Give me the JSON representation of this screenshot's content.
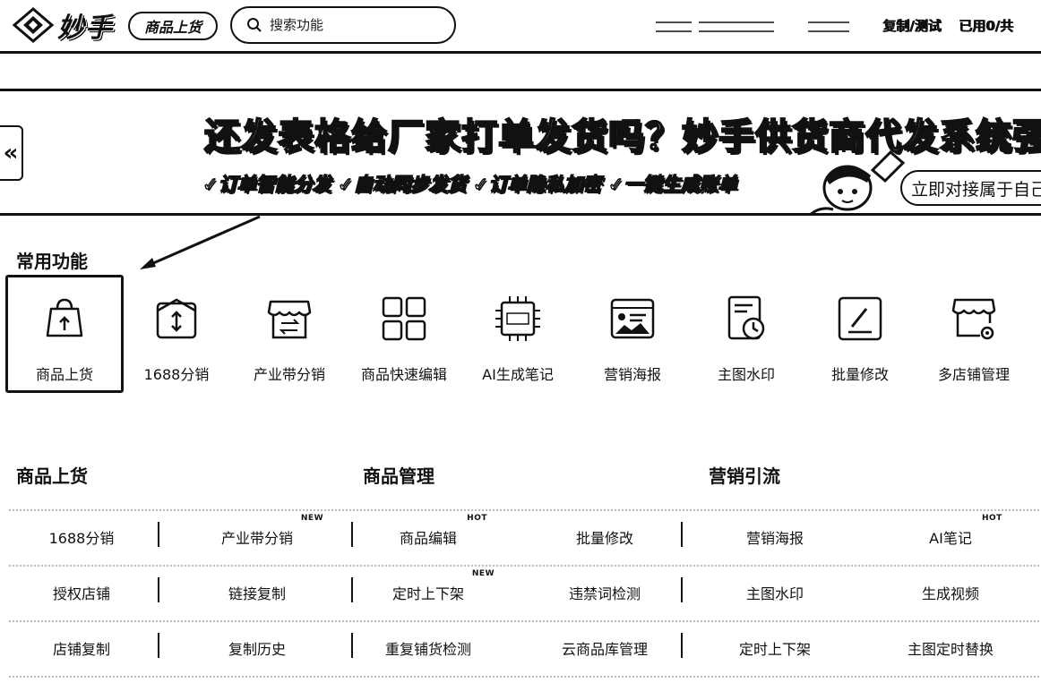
{
  "header": {
    "logo_text": "妙手",
    "module_label": "商品上货",
    "search_placeholder": "搜索功能",
    "link_review": "复制/测试",
    "link_usage": "已用0/共"
  },
  "banner": {
    "prev_icon": "«",
    "headline": "还发表格给厂家打单发货吗？妙手供货商代发系统强势来袭",
    "features": "✓订单智能分发 ✓自动同步发货 ✓订单隐私加密 ✓一键生成账单",
    "cta": "立即对接属于自己的"
  },
  "common": {
    "title": "常用功能",
    "items": [
      {
        "label": "商品上货",
        "icon": "shopping-bag-upload-icon"
      },
      {
        "label": "1688分销",
        "icon": "box-transfer-icon"
      },
      {
        "label": "产业带分销",
        "icon": "storefront-exchange-icon"
      },
      {
        "label": "商品快速编辑",
        "icon": "grid-four-icon"
      },
      {
        "label": "AI生成笔记",
        "icon": "ai-chip-icon"
      },
      {
        "label": "营销海报",
        "icon": "poster-icon"
      },
      {
        "label": "主图水印",
        "icon": "image-watermark-icon"
      },
      {
        "label": "批量修改",
        "icon": "batch-edit-icon"
      },
      {
        "label": "多店铺管理",
        "icon": "store-settings-icon"
      }
    ]
  },
  "categories": [
    {
      "title": "商品上货",
      "rows": [
        [
          {
            "label": "1688分销"
          },
          {
            "label": "产业带分销",
            "badge": "NEW"
          }
        ],
        [
          {
            "label": "授权店铺"
          },
          {
            "label": "链接复制"
          }
        ],
        [
          {
            "label": "店铺复制"
          },
          {
            "label": "复制历史"
          }
        ]
      ]
    },
    {
      "title": "商品管理",
      "rows": [
        [
          {
            "label": "商品编辑",
            "badge": "HOT"
          },
          {
            "label": "批量修改"
          }
        ],
        [
          {
            "label": "定时上下架",
            "badge": "NEW"
          },
          {
            "label": "违禁词检测"
          }
        ],
        [
          {
            "label": "重复铺货检测"
          },
          {
            "label": "云商品库管理"
          }
        ]
      ]
    },
    {
      "title": "营销引流",
      "rows": [
        [
          {
            "label": "营销海报"
          },
          {
            "label": "AI笔记",
            "badge": "HOT"
          }
        ],
        [
          {
            "label": "主图水印"
          },
          {
            "label": "生成视频"
          }
        ],
        [
          {
            "label": "定时上下架"
          },
          {
            "label": "主图定时替换"
          }
        ]
      ]
    }
  ]
}
